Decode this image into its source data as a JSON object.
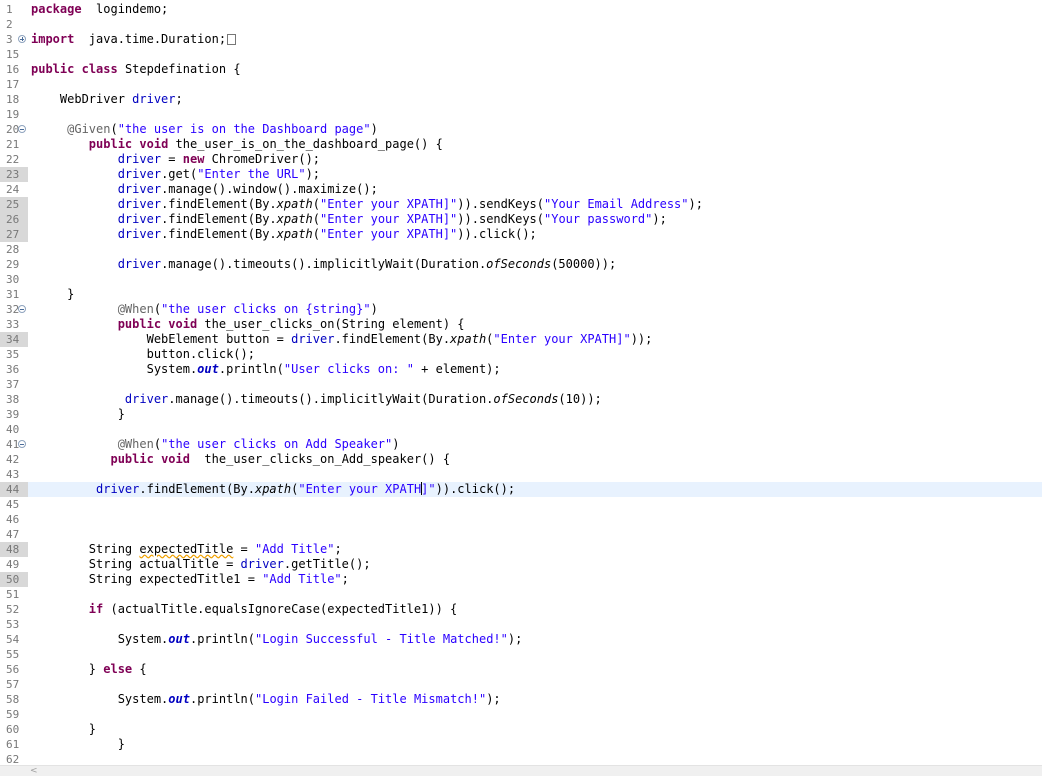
{
  "editor": {
    "lines": [
      {
        "num": "1",
        "y": 0,
        "segs": [
          [
            "kw",
            "package"
          ],
          [
            "",
            "  logindemo;"
          ]
        ]
      },
      {
        "num": "2",
        "y": 1,
        "segs": []
      },
      {
        "num": "3",
        "y": 2,
        "fold": "plus",
        "segs": [
          [
            "kw",
            "import"
          ],
          [
            "",
            "  java.time.Duration;"
          ]
        ],
        "box": true
      },
      {
        "num": "15",
        "y": 3,
        "segs": []
      },
      {
        "num": "16",
        "y": 4,
        "segs": [
          [
            "kw",
            "public"
          ],
          [
            "",
            " "
          ],
          [
            "kw",
            "class"
          ],
          [
            "",
            " Stepdefination {"
          ]
        ]
      },
      {
        "num": "17",
        "y": 5,
        "segs": []
      },
      {
        "num": "18",
        "y": 6,
        "segs": [
          [
            "",
            "    WebDriver "
          ],
          [
            "fld",
            "driver"
          ],
          [
            "",
            ";"
          ]
        ]
      },
      {
        "num": "19",
        "y": 7,
        "segs": []
      },
      {
        "num": "20",
        "y": 8,
        "fold": "minus",
        "segs": [
          [
            "",
            "     "
          ],
          [
            "ann",
            "@Given"
          ],
          [
            "",
            "("
          ],
          [
            "str",
            "\"the user is on the Dashboard page\""
          ],
          [
            "",
            ")"
          ]
        ]
      },
      {
        "num": "21",
        "y": 9,
        "segs": [
          [
            "",
            "        "
          ],
          [
            "kw",
            "public"
          ],
          [
            "",
            " "
          ],
          [
            "kw",
            "void"
          ],
          [
            "",
            " the_user_is_on_the_dashboard_page() {"
          ]
        ]
      },
      {
        "num": "22",
        "y": 10,
        "segs": [
          [
            "",
            "            "
          ],
          [
            "fld",
            "driver"
          ],
          [
            "",
            " = "
          ],
          [
            "kw",
            "new"
          ],
          [
            "",
            " ChromeDriver();"
          ]
        ]
      },
      {
        "num": "23",
        "y": 11,
        "hl": true,
        "segs": [
          [
            "",
            "            "
          ],
          [
            "fld",
            "driver"
          ],
          [
            "",
            ".get("
          ],
          [
            "str",
            "\"Enter the URL\""
          ],
          [
            "",
            ");"
          ]
        ]
      },
      {
        "num": "24",
        "y": 12,
        "segs": [
          [
            "",
            "            "
          ],
          [
            "fld",
            "driver"
          ],
          [
            "",
            ".manage().window().maximize();"
          ]
        ]
      },
      {
        "num": "25",
        "y": 13,
        "hl": true,
        "segs": [
          [
            "",
            "            "
          ],
          [
            "fld",
            "driver"
          ],
          [
            "",
            ".findElement(By."
          ],
          [
            "it",
            "xpath"
          ],
          [
            "",
            "("
          ],
          [
            "str",
            "\"Enter your XPATH]\""
          ],
          [
            "",
            ")).sendKeys("
          ],
          [
            "str",
            "\"Your Email Address\""
          ],
          [
            "",
            ");"
          ]
        ]
      },
      {
        "num": "26",
        "y": 14,
        "hl": true,
        "segs": [
          [
            "",
            "            "
          ],
          [
            "fld",
            "driver"
          ],
          [
            "",
            ".findElement(By."
          ],
          [
            "it",
            "xpath"
          ],
          [
            "",
            "("
          ],
          [
            "str",
            "\"Enter your XPATH]\""
          ],
          [
            "",
            ")).sendKeys("
          ],
          [
            "str",
            "\"Your password\""
          ],
          [
            "",
            ");"
          ]
        ]
      },
      {
        "num": "27",
        "y": 15,
        "hl": true,
        "segs": [
          [
            "",
            "            "
          ],
          [
            "fld",
            "driver"
          ],
          [
            "",
            ".findElement(By."
          ],
          [
            "it",
            "xpath"
          ],
          [
            "",
            "("
          ],
          [
            "str",
            "\"Enter your XPATH]\""
          ],
          [
            "",
            ")).click();"
          ]
        ]
      },
      {
        "num": "28",
        "y": 16,
        "segs": []
      },
      {
        "num": "29",
        "y": 17,
        "segs": [
          [
            "",
            "            "
          ],
          [
            "fld",
            "driver"
          ],
          [
            "",
            ".manage().timeouts().implicitlyWait(Duration."
          ],
          [
            "it",
            "ofSeconds"
          ],
          [
            "",
            "(50000));"
          ]
        ]
      },
      {
        "num": "30",
        "y": 18,
        "segs": []
      },
      {
        "num": "31",
        "y": 19,
        "segs": [
          [
            "",
            "     }"
          ]
        ]
      },
      {
        "num": "32",
        "y": 20,
        "fold": "minus",
        "segs": [
          [
            "",
            "            "
          ],
          [
            "ann",
            "@When"
          ],
          [
            "",
            "("
          ],
          [
            "str",
            "\"the user clicks on {string}\""
          ],
          [
            "",
            ")"
          ]
        ]
      },
      {
        "num": "33",
        "y": 21,
        "segs": [
          [
            "",
            "            "
          ],
          [
            "kw",
            "public"
          ],
          [
            "",
            " "
          ],
          [
            "kw",
            "void"
          ],
          [
            "",
            " the_user_clicks_on(String element) {"
          ]
        ]
      },
      {
        "num": "34",
        "y": 22,
        "hl": true,
        "segs": [
          [
            "",
            "                WebElement button = "
          ],
          [
            "fld",
            "driver"
          ],
          [
            "",
            ".findElement(By."
          ],
          [
            "it",
            "xpath"
          ],
          [
            "",
            "("
          ],
          [
            "str",
            "\"Enter your XPATH]\""
          ],
          [
            "",
            "));"
          ]
        ]
      },
      {
        "num": "35",
        "y": 23,
        "segs": [
          [
            "",
            "                button.click();"
          ]
        ]
      },
      {
        "num": "36",
        "y": 24,
        "segs": [
          [
            "",
            "                System."
          ],
          [
            "itb",
            "out"
          ],
          [
            "",
            ".println("
          ],
          [
            "str",
            "\"User clicks on: \""
          ],
          [
            "",
            " + element);"
          ]
        ]
      },
      {
        "num": "37",
        "y": 25,
        "segs": []
      },
      {
        "num": "38",
        "y": 26,
        "segs": [
          [
            "",
            "             "
          ],
          [
            "fld",
            "driver"
          ],
          [
            "",
            ".manage().timeouts().implicitlyWait(Duration."
          ],
          [
            "it",
            "ofSeconds"
          ],
          [
            "",
            "(10));"
          ]
        ]
      },
      {
        "num": "39",
        "y": 27,
        "segs": [
          [
            "",
            "            }"
          ]
        ]
      },
      {
        "num": "40",
        "y": 28,
        "segs": []
      },
      {
        "num": "41",
        "y": 29,
        "fold": "minus",
        "segs": [
          [
            "",
            "            "
          ],
          [
            "ann",
            "@When"
          ],
          [
            "",
            "("
          ],
          [
            "str",
            "\"the user clicks on Add Speaker\""
          ],
          [
            "",
            ")"
          ]
        ]
      },
      {
        "num": "42",
        "y": 30,
        "segs": [
          [
            "",
            "           "
          ],
          [
            "kw",
            "public"
          ],
          [
            "",
            " "
          ],
          [
            "kw",
            "void"
          ],
          [
            "",
            "  the_user_clicks_on_Add_speaker() {"
          ]
        ]
      },
      {
        "num": "43",
        "y": 31,
        "segs": []
      },
      {
        "num": "44",
        "y": 32,
        "current": true,
        "hl": true,
        "segs": [
          [
            "",
            "         "
          ],
          [
            "fld",
            "driver"
          ],
          [
            "",
            ".findElement(By."
          ],
          [
            "it",
            "xpath"
          ],
          [
            "",
            "("
          ],
          [
            "str",
            "\"Enter your XPATH"
          ],
          [
            "caret",
            ""
          ],
          [
            "str",
            "]\""
          ],
          [
            "",
            ")).click();"
          ]
        ]
      },
      {
        "num": "45",
        "y": 33,
        "segs": []
      },
      {
        "num": "46",
        "y": 34,
        "segs": []
      },
      {
        "num": "47",
        "y": 35,
        "segs": []
      },
      {
        "num": "48",
        "y": 36,
        "hl": true,
        "segs": [
          [
            "",
            "        String "
          ],
          [
            "warn",
            "expectedTitle"
          ],
          [
            "",
            " = "
          ],
          [
            "str",
            "\"Add Title\""
          ],
          [
            "",
            ";"
          ]
        ]
      },
      {
        "num": "49",
        "y": 37,
        "segs": [
          [
            "",
            "        String actualTitle = "
          ],
          [
            "fld",
            "driver"
          ],
          [
            "",
            ".getTitle();"
          ]
        ]
      },
      {
        "num": "50",
        "y": 38,
        "hl": true,
        "segs": [
          [
            "",
            "        String expectedTitle1 = "
          ],
          [
            "str",
            "\"Add Title\""
          ],
          [
            "",
            ";"
          ]
        ]
      },
      {
        "num": "51",
        "y": 39,
        "segs": []
      },
      {
        "num": "52",
        "y": 40,
        "segs": [
          [
            "",
            "        "
          ],
          [
            "kw",
            "if"
          ],
          [
            "",
            " (actualTitle.equalsIgnoreCase(expectedTitle1)) {"
          ]
        ]
      },
      {
        "num": "53",
        "y": 41,
        "segs": []
      },
      {
        "num": "54",
        "y": 42,
        "segs": [
          [
            "",
            "            System."
          ],
          [
            "itb",
            "out"
          ],
          [
            "",
            ".println("
          ],
          [
            "str",
            "\"Login Successful - Title Matched!\""
          ],
          [
            "",
            ");"
          ]
        ]
      },
      {
        "num": "55",
        "y": 43,
        "segs": []
      },
      {
        "num": "56",
        "y": 44,
        "segs": [
          [
            "",
            "        } "
          ],
          [
            "kw",
            "else"
          ],
          [
            "",
            " {"
          ]
        ]
      },
      {
        "num": "57",
        "y": 45,
        "segs": []
      },
      {
        "num": "58",
        "y": 46,
        "segs": [
          [
            "",
            "            System."
          ],
          [
            "itb",
            "out"
          ],
          [
            "",
            ".println("
          ],
          [
            "str",
            "\"Login Failed - Title Mismatch!\""
          ],
          [
            "",
            ");"
          ]
        ]
      },
      {
        "num": "59",
        "y": 47,
        "segs": []
      },
      {
        "num": "60",
        "y": 48,
        "segs": [
          [
            "",
            "        }"
          ]
        ]
      },
      {
        "num": "61",
        "y": 49,
        "segs": [
          [
            "",
            "            }"
          ]
        ]
      },
      {
        "num": "62",
        "y": 50,
        "segs": []
      }
    ]
  },
  "scrollbar": {
    "left_arrow": "<"
  },
  "colors": {
    "keyword": "#7f0055",
    "string": "#2a00ff",
    "field": "#0000c0",
    "annotation": "#646464",
    "current_line": "#e8f2fe"
  }
}
